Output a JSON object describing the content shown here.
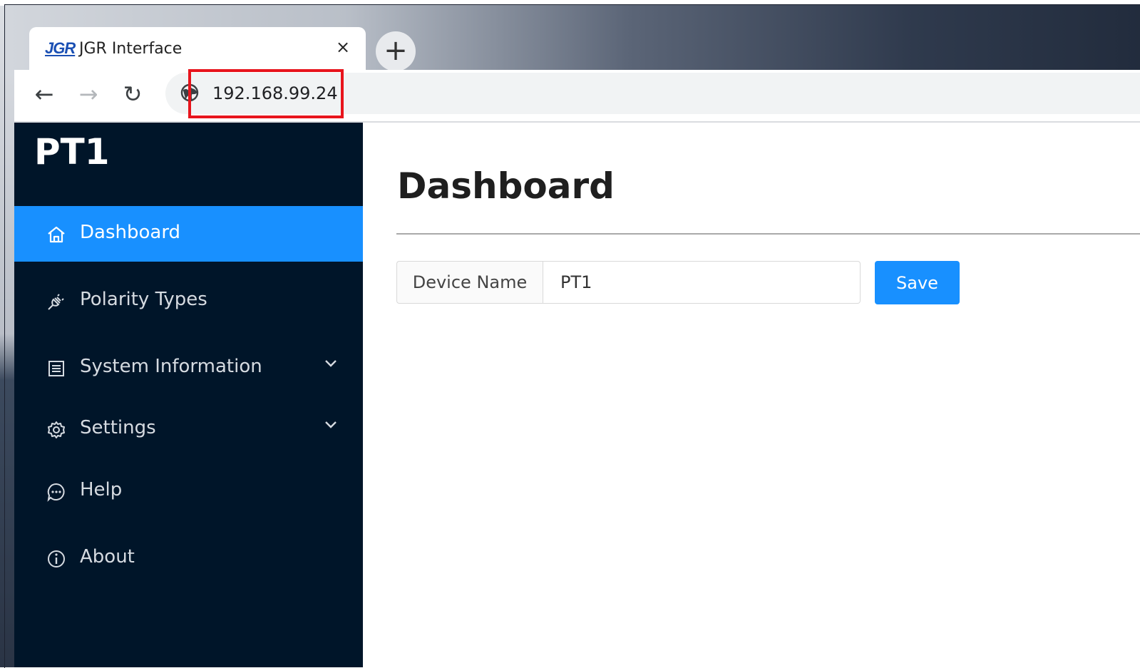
{
  "browser": {
    "tab": {
      "logo_text": "JGR",
      "title": "JGR Interface",
      "close_glyph": "×"
    },
    "new_tab_glyph": "+",
    "nav": {
      "back": "←",
      "forward": "→",
      "reload": "↻"
    },
    "address": {
      "url": "192.168.99.24",
      "icon": "globe-icon"
    },
    "highlight_color": "#e8141c"
  },
  "sidebar": {
    "brand": "PT1",
    "items": [
      {
        "label": "Dashboard",
        "icon": "home-icon",
        "active": true
      },
      {
        "label": "Polarity Types",
        "icon": "plug-icon"
      },
      {
        "label": "System Information",
        "icon": "list-icon",
        "expandable": true
      },
      {
        "label": "Settings",
        "icon": "gear-icon",
        "expandable": true
      },
      {
        "label": "Help",
        "icon": "chat-icon"
      },
      {
        "label": "About",
        "icon": "info-icon"
      }
    ]
  },
  "main": {
    "title": "Dashboard",
    "form": {
      "addon_label": "Device Name",
      "value": "PT1",
      "save_label": "Save"
    }
  },
  "colors": {
    "sidebar_bg": "#001529",
    "accent": "#1890ff",
    "text_on_dark": "#d6dbe1"
  }
}
